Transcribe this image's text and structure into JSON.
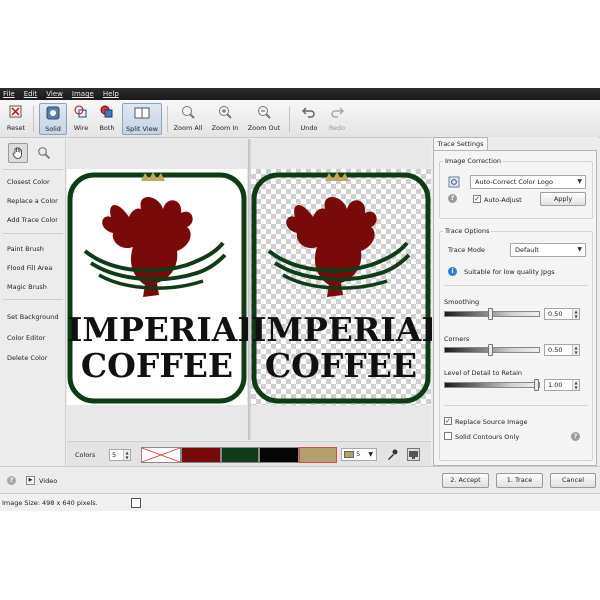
{
  "menu": [
    "File",
    "Edit",
    "View",
    "Image",
    "Help"
  ],
  "toolbar": {
    "reset": "Reset",
    "solid": "Solid",
    "wire": "Wire",
    "both": "Both",
    "split_view": "Split View",
    "zoom_all": "Zoom All",
    "zoom_in": "Zoom In",
    "zoom_out": "Zoom Out",
    "undo": "Undo",
    "redo": "Redo"
  },
  "left_panel": {
    "items": [
      "Closest Color",
      "Replace a Color",
      "Add Trace Color",
      "Paint Brush",
      "Flood Fill Area",
      "Magic Brush",
      "Set Background",
      "Color Editor",
      "Delete Color"
    ]
  },
  "canvas": {
    "logo_line1": "IMPERIAL",
    "logo_line2": "COFFEE"
  },
  "colors_strip": {
    "label": "Colors",
    "count": "5",
    "swatch_count": "5",
    "swatches": [
      "transparent",
      "#7a0a0a",
      "#0f3b16",
      "#050505",
      "#b4a06c"
    ]
  },
  "trace_settings": {
    "tab": "Trace Settings",
    "image_correction": {
      "title": "Image Correction",
      "mode": "Auto-Correct Color Logo",
      "auto_adjust_label": "Auto-Adjust",
      "apply": "Apply"
    },
    "trace_options": {
      "title": "Trace Options",
      "trace_mode_label": "Trace Mode",
      "trace_mode_value": "Default",
      "hint": "Suitable for low quality Jpgs",
      "smoothing_label": "Smoothing",
      "smoothing_value": "0.50",
      "corners_label": "Corners",
      "corners_value": "0.50",
      "detail_label": "Level of Detail to Retain",
      "detail_value": "1.00",
      "replace_source": "Replace Source Image",
      "solid_contours": "Solid Contours Only"
    }
  },
  "bottom": {
    "video": "Video",
    "accept": "2. Accept",
    "trace": "1. Trace",
    "cancel": "Cancel"
  },
  "status": {
    "image_size": "Image Size: 498 x 640 pixels."
  }
}
